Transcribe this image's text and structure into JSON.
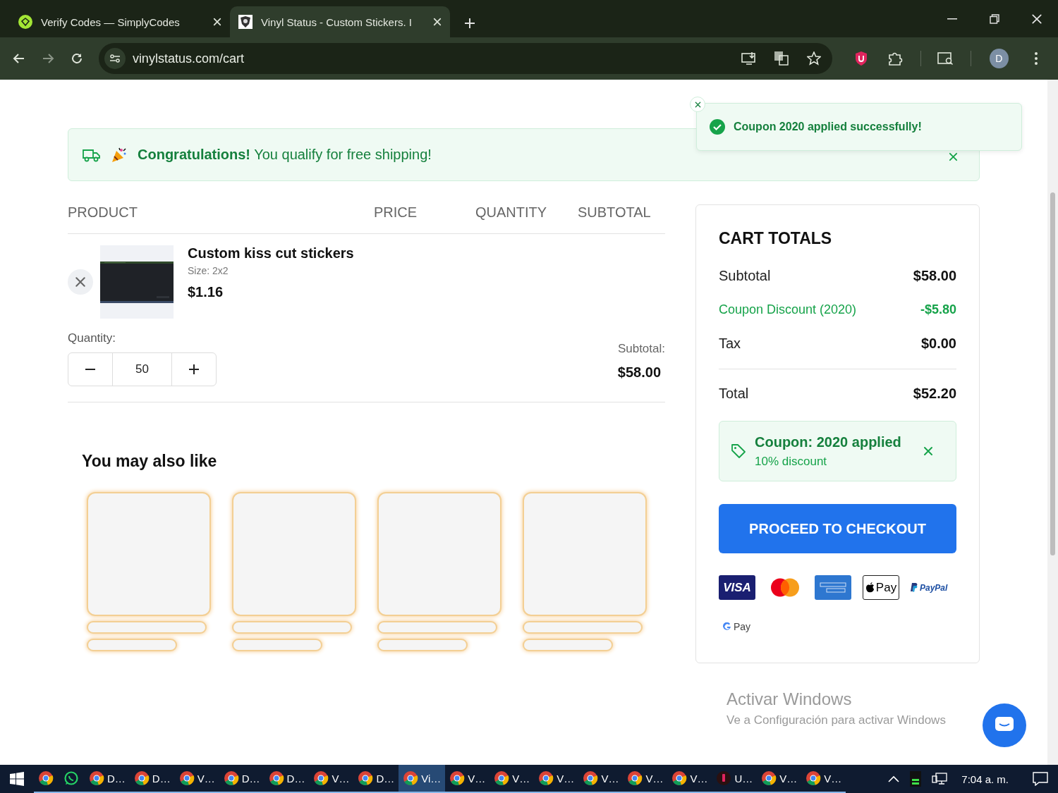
{
  "browser": {
    "tabs": [
      {
        "title": "Verify Codes — SimplyCodes",
        "selected": false
      },
      {
        "title": "Vinyl Status - Custom Stickers. I",
        "selected": true
      }
    ],
    "url": "vinylstatus.com/cart",
    "profile_initial": "D"
  },
  "toast": {
    "message": "Coupon 2020 applied successfully!"
  },
  "banner": {
    "message": "**Congratulations!** You qualify for free shipping!"
  },
  "cart": {
    "columns": [
      "PRODUCT",
      "PRICE",
      "QUANTITY",
      "SUBTOTAL"
    ],
    "items": [
      {
        "name": "Custom kiss cut stickers",
        "size": "Size: 2x2",
        "price": "$1.16",
        "quantity_label": "Quantity:",
        "quantity": "50",
        "subtotal_label": "Subtotal:",
        "subtotal": "$58.00"
      }
    ]
  },
  "recommendations": {
    "title": "You may also like",
    "cards": [
      {
        "kind": "skeleton"
      },
      {
        "kind": "skeleton"
      },
      {
        "kind": "skeleton"
      },
      {
        "kind": "skeleton"
      }
    ]
  },
  "totals": {
    "title": "CART TOTALS",
    "rows": [
      {
        "label": "Subtotal",
        "value": "$58.00",
        "kind": "normal"
      },
      {
        "label": "Coupon Discount (2020)",
        "value": "-$5.80",
        "kind": "discount"
      },
      {
        "label": "Tax",
        "value": "$0.00",
        "kind": "normal"
      },
      {
        "label": "Total",
        "value": "$52.20",
        "kind": "total"
      }
    ],
    "coupon": {
      "title": "Coupon: 2020 applied",
      "detail": "10% discount"
    },
    "checkout": "PROCEED TO CHECKOUT",
    "payments": [
      {
        "kind": "visa",
        "label": "VISA"
      },
      {
        "kind": "mastercard"
      },
      {
        "kind": "amex"
      },
      {
        "kind": "applepay",
        "label": "Pay"
      },
      {
        "kind": "paypal",
        "label": "PayPal"
      },
      {
        "kind": "gpay",
        "label": "Pay"
      }
    ]
  },
  "windows_notice": {
    "title": "Activar Windows",
    "detail": "Ve a Configuración para activar Windows"
  },
  "taskbar": {
    "apps": [
      {
        "kind": "chrome",
        "selected": false
      },
      {
        "kind": "whatsapp",
        "selected": false
      },
      {
        "kind": "chrome",
        "label": "D…",
        "selected": false
      },
      {
        "kind": "chrome",
        "label": "D…",
        "selected": false
      },
      {
        "kind": "chrome",
        "label": "V…",
        "selected": false
      },
      {
        "kind": "chrome",
        "label": "D…",
        "selected": false
      },
      {
        "kind": "chrome",
        "label": "D…",
        "selected": false
      },
      {
        "kind": "chrome",
        "label": "V…",
        "selected": false
      },
      {
        "kind": "chrome",
        "label": "D…",
        "selected": false
      },
      {
        "kind": "chrome",
        "label": "Vi…",
        "selected": true
      },
      {
        "kind": "chrome",
        "label": "V…",
        "selected": false
      },
      {
        "kind": "chrome",
        "label": "V…",
        "selected": false
      },
      {
        "kind": "chrome",
        "label": "V…",
        "selected": false
      },
      {
        "kind": "chrome",
        "label": "V…",
        "selected": false
      },
      {
        "kind": "chrome",
        "label": "V…",
        "selected": false
      },
      {
        "kind": "chrome",
        "label": "V…",
        "selected": false
      },
      {
        "kind": "app",
        "label": "U…",
        "selected": false
      },
      {
        "kind": "chrome",
        "label": "V…",
        "selected": false
      },
      {
        "kind": "chrome",
        "label": "V…",
        "selected": false
      }
    ],
    "time": "7:04 a. m."
  }
}
